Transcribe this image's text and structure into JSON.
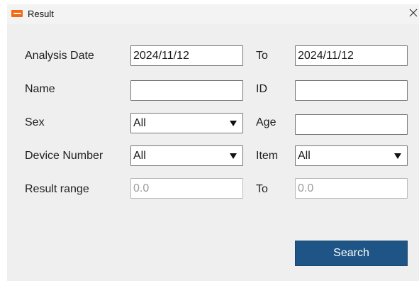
{
  "window": {
    "title": "Result",
    "icon": "app-logo-icon",
    "close_icon": "close-icon"
  },
  "form": {
    "analysis_date": {
      "label": "Analysis Date",
      "from": "2024/11/12",
      "to_label": "To",
      "to": "2024/11/12"
    },
    "name": {
      "label": "Name",
      "value": ""
    },
    "id": {
      "label": "ID",
      "value": ""
    },
    "sex": {
      "label": "Sex",
      "selected": "All"
    },
    "age": {
      "label": "Age",
      "value": ""
    },
    "device_number": {
      "label": "Device Number",
      "selected": "All"
    },
    "item": {
      "label": "Item",
      "selected": "All"
    },
    "result_range": {
      "label": "Result range",
      "from": "0.0",
      "to_label": "To",
      "to": "0.0"
    }
  },
  "actions": {
    "search_label": "Search"
  },
  "colors": {
    "window_bg": "#efefef",
    "button_bg": "#1e5586",
    "app_icon": "#f36a14"
  }
}
